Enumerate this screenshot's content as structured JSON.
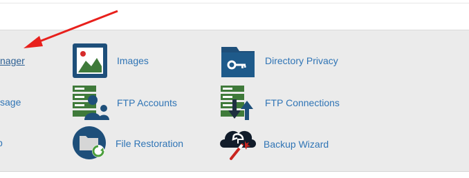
{
  "left_column": {
    "row1": "nager",
    "row2": "sage",
    "row3": "p"
  },
  "items": {
    "images": "Images",
    "directory_privacy": "Directory Privacy",
    "ftp_accounts": "FTP Accounts",
    "ftp_connections": "FTP Connections",
    "file_restoration": "File Restoration",
    "backup_wizard": "Backup Wizard"
  },
  "colors": {
    "link": "#2f74b5",
    "icon_navy": "#1e4f7a",
    "icon_green": "#3f7a3a",
    "arrow_red": "#e8201c"
  },
  "icons": [
    "image-icon",
    "directory-privacy-icon",
    "ftp-accounts-icon",
    "ftp-connections-icon",
    "file-restoration-icon",
    "backup-wizard-icon"
  ]
}
